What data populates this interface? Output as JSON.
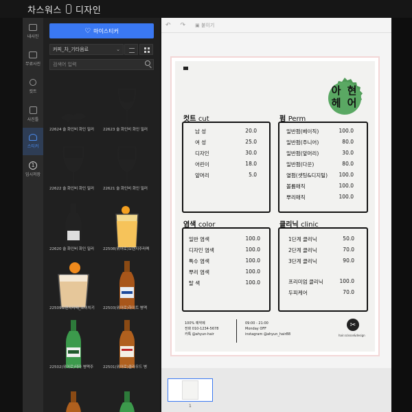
{
  "app": {
    "title": "차스워스",
    "title_suffix": "디자인"
  },
  "rail": [
    {
      "label": "내사진"
    },
    {
      "label": "무료사진"
    },
    {
      "label": "컷트"
    },
    {
      "label": "사진틀"
    },
    {
      "label": "스티커",
      "active": true
    },
    {
      "label": "임시저장",
      "num": "1"
    }
  ],
  "panel": {
    "my_sticker_label": "마이스티커",
    "category_value": "커피_차_기타음료",
    "search_placeholder": "검색어 입력"
  },
  "stickers": [
    {
      "caption": "22624 술 화인비 화인 밀러"
    },
    {
      "caption": "22623 술 화인비 화인 밀러"
    },
    {
      "caption": "22622 술 화인비 화인 밀러"
    },
    {
      "caption": "22621 술 화인비 화인 밀러"
    },
    {
      "caption": "22620 술 화인비 화인 밀러"
    },
    {
      "caption": "22508(위어로)오렌지주라렉"
    },
    {
      "caption": "22509오렌지라떼_조이치키"
    },
    {
      "caption": "22503(위어로)하이트 병맥"
    },
    {
      "caption": "22502(위어로)테라 병맥주"
    },
    {
      "caption": "22501(위어로)클라우드 병"
    }
  ],
  "toolbar": {
    "undo": "↶",
    "redo": "↷",
    "paste": "붙이기"
  },
  "menu": {
    "badge_line1": "아 현",
    "badge_line2": "헤 어",
    "cut": {
      "title_ko": "컷트",
      "title_en": "cut",
      "items": [
        {
          "name": "남 성",
          "price": "20.0"
        },
        {
          "name": "여 성",
          "price": "25.0"
        },
        {
          "name": "디자인",
          "price": "30.0"
        },
        {
          "name": "어린이",
          "price": "18.0"
        },
        {
          "name": "앞머리",
          "price": "5.0"
        }
      ]
    },
    "perm": {
      "title_ko": "펌",
      "title_en": "Perm",
      "items": [
        {
          "name": "일반펌(베이직)",
          "price": "100.0"
        },
        {
          "name": "일반펌(주니어)",
          "price": "80.0"
        },
        {
          "name": "일반펌(앞머리)",
          "price": "30.0"
        },
        {
          "name": "일반펌(다운)",
          "price": "80.0"
        },
        {
          "name": "열펌(셋팅&디지털)",
          "price": "100.0"
        },
        {
          "name": "볼륨매직",
          "price": "100.0"
        },
        {
          "name": "뿌리매직",
          "price": "100.0"
        }
      ]
    },
    "color": {
      "title_ko": "염색",
      "title_en": "color",
      "items": [
        {
          "name": "일반 염색",
          "price": "100.0"
        },
        {
          "name": "디자인 염색",
          "price": "100.0"
        },
        {
          "name": "특수 염색",
          "price": "100.0"
        },
        {
          "name": "뿌리 염색",
          "price": "100.0"
        },
        {
          "name": "탈 색",
          "price": "100.0"
        }
      ]
    },
    "clinic": {
      "title_ko": "클리닉",
      "title_en": "clinic",
      "items": [
        {
          "name": "1단계 클리닉",
          "price": "50.0"
        },
        {
          "name": "2단계 클리닉",
          "price": "70.0"
        },
        {
          "name": "3단계 클리닉",
          "price": "90.0"
        },
        {
          "name": "프리미엄 클리닉",
          "price": "100.0"
        },
        {
          "name": "두피케어",
          "price": "70.0"
        }
      ]
    },
    "footer_left": [
      "100% 예약제",
      "전화 010-1234-5678",
      "카톡 @ahyun-hair"
    ],
    "footer_right": [
      "09:00 - 21:00",
      "Monday OFF",
      "instagram @ahyun_hair88"
    ],
    "scissor_caption": "hair.scissor&design"
  },
  "thumbs": {
    "page_number": "1"
  },
  "colors": {
    "accent": "#3a78f2",
    "badge": "#4f9a57"
  }
}
